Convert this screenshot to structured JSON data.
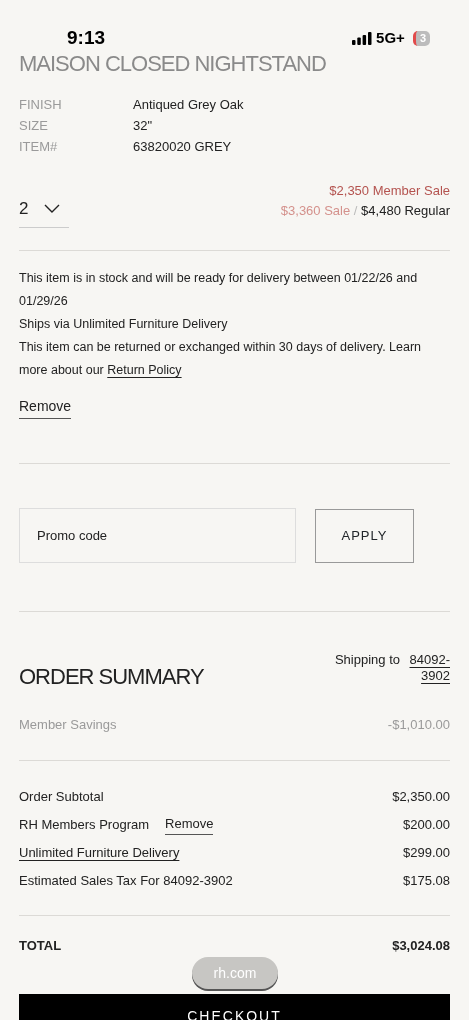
{
  "status_bar": {
    "time": "9:13",
    "network": "5G+",
    "battery": "3"
  },
  "product": {
    "title": "MAISON CLOSED NIGHTSTAND",
    "details": [
      {
        "label": "FINISH",
        "value": "Antiqued Grey Oak"
      },
      {
        "label": "SIZE",
        "value": "32\""
      },
      {
        "label": "ITEM#",
        "value": "63820020 GREY"
      }
    ],
    "quantity": "2",
    "member_price": "$2,350 Member Sale",
    "sale_price": "$3,360 Sale",
    "separator": "/",
    "regular_price": "$4,480 Regular",
    "availability": "This item is in stock and will be ready for delivery between 01/22/26 and 01/29/26",
    "shipping": "Ships via Unlimited Furniture Delivery",
    "returns": "This item can be returned or exchanged within 30 days of delivery.  Learn more about our",
    "return_link": "Return Policy",
    "remove": "Remove"
  },
  "promo": {
    "placeholder": "Promo code",
    "button": "APPLY"
  },
  "order_summary": {
    "title": "ORDER SUMMARY",
    "shipping_label": "Shipping to",
    "shipping_zip": "84092-3902",
    "savings": {
      "label": "Member Savings",
      "value": "-$1,010.00"
    },
    "lines": [
      {
        "kind": "plain",
        "label": "Order Subtotal",
        "value": "$2,350.00"
      },
      {
        "kind": "removable",
        "label": "RH Members Program",
        "action": "Remove",
        "value": "$200.00"
      },
      {
        "kind": "link",
        "label": "Unlimited Furniture Delivery",
        "value": "$299.00"
      },
      {
        "kind": "plain",
        "label": "Estimated Sales Tax For 84092-3902",
        "value": "$175.08"
      }
    ],
    "total": {
      "label": "TOTAL",
      "value": "$3,024.08"
    },
    "checkout": "CHECKOUT"
  },
  "url_pill": "rh.com"
}
